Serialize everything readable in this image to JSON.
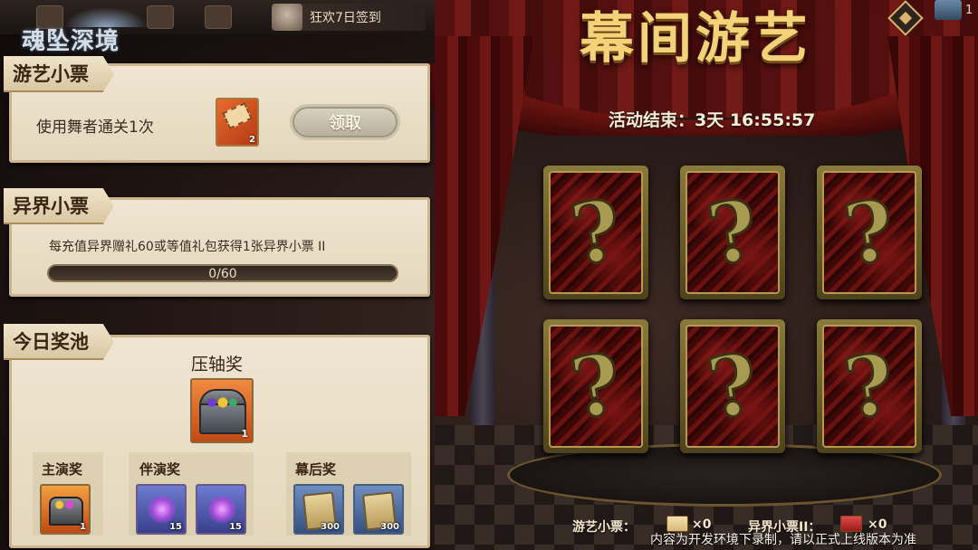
{
  "app": {
    "logo_text": "魂坠深境",
    "signin_label": "狂欢7日签到",
    "top_right_count": "1"
  },
  "event": {
    "title": "幕间游艺",
    "timer": "活动结束：3天 16:55:57"
  },
  "sections": {
    "ticket": {
      "tag": "游艺小票",
      "task": "使用舞者通关1次",
      "reward_count": "2",
      "claim_label": "领取"
    },
    "otherworld": {
      "tag": "异界小票",
      "task": "每充值异界赠礼60或等值礼包获得1张异界小票 II",
      "progress_text": "0/60",
      "progress_value": 0,
      "progress_max": 60
    },
    "pool": {
      "tag": "今日奖池",
      "grand_prize_title": "压轴奖",
      "grand_prize_count": "1",
      "tiers": [
        {
          "label": "主演奖",
          "rewards": [
            {
              "icon": "treasure-chest",
              "count": "1"
            }
          ]
        },
        {
          "label": "伴演奖",
          "rewards": [
            {
              "icon": "purple-crystal",
              "count": "15"
            },
            {
              "icon": "purple-crystal",
              "count": "15"
            }
          ]
        },
        {
          "label": "幕后奖",
          "rewards": [
            {
              "icon": "scroll",
              "count": "300"
            },
            {
              "icon": "scroll",
              "count": "300"
            }
          ]
        }
      ]
    }
  },
  "cards": [
    {
      "face": "?"
    },
    {
      "face": "?"
    },
    {
      "face": "?"
    },
    {
      "face": "?"
    },
    {
      "face": "?"
    },
    {
      "face": "?"
    }
  ],
  "footer": {
    "ticket_label": "游艺小票：",
    "ticket_count": "×0",
    "otherworld_label": "异界小票II：",
    "otherworld_count": "×0",
    "watermark": "内容为开发环境下录制，请以正式上线版本为准"
  },
  "colors": {
    "gold": "#f3d27a",
    "curtain_red": "#6b1410",
    "panel_bg": "#efe5d1"
  }
}
